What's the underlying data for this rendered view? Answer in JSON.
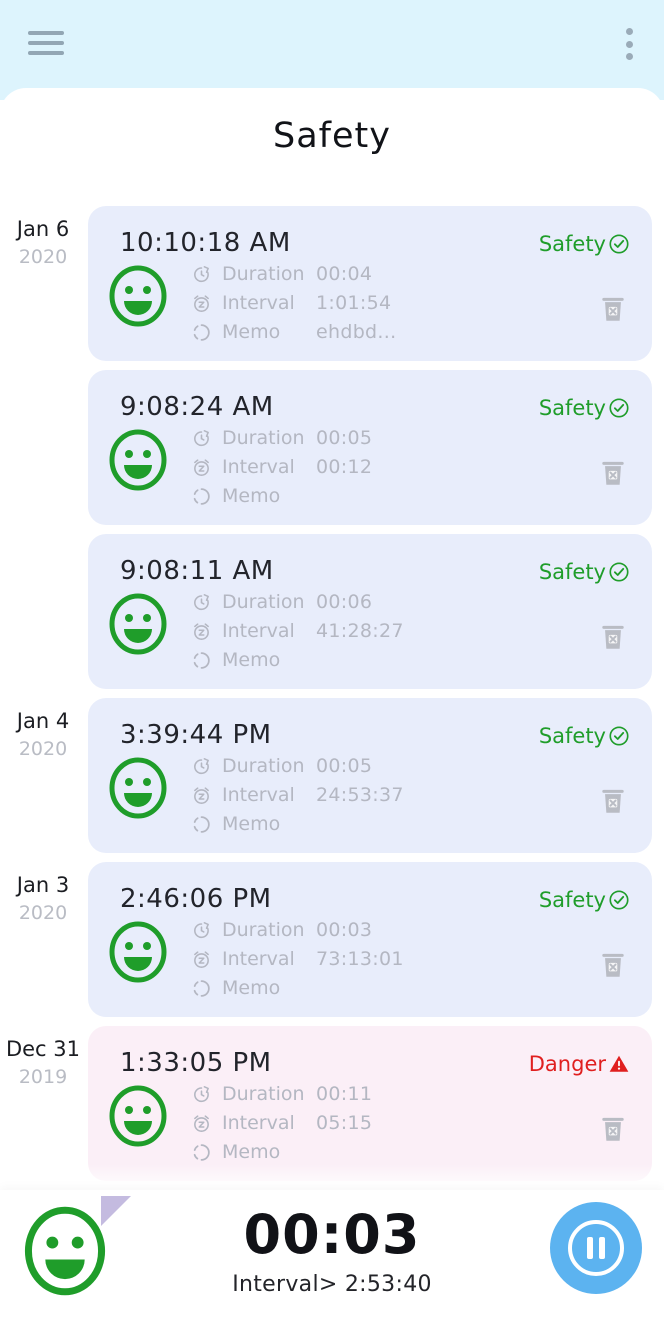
{
  "header": {
    "menu_icon": "hamburger-icon",
    "overflow_icon": "kebab-menu-icon"
  },
  "page": {
    "title": "Safety"
  },
  "labels": {
    "duration": "Duration",
    "interval": "Interval",
    "memo": "Memo",
    "duration_icon": "restore-clock-icon",
    "interval_icon": "snooze-z-icon",
    "memo_icon": "dashed-circle-icon",
    "delete_icon": "trash-x-icon",
    "face_icon": "smiley-face-icon"
  },
  "entries": [
    {
      "date_day": "Jan 6",
      "date_year": "2020",
      "time": "10:10:18 AM",
      "status": "Safety",
      "status_type": "safety",
      "duration": "00:04",
      "interval": "1:01:54",
      "memo": "ehdbd..."
    },
    {
      "date_day": "",
      "date_year": "",
      "time": "9:08:24 AM",
      "status": "Safety",
      "status_type": "safety",
      "duration": "00:05",
      "interval": "00:12",
      "memo": ""
    },
    {
      "date_day": "",
      "date_year": "",
      "time": "9:08:11 AM",
      "status": "Safety",
      "status_type": "safety",
      "duration": "00:06",
      "interval": "41:28:27",
      "memo": ""
    },
    {
      "date_day": "Jan 4",
      "date_year": "2020",
      "time": "3:39:44 PM",
      "status": "Safety",
      "status_type": "safety",
      "duration": "00:05",
      "interval": "24:53:37",
      "memo": ""
    },
    {
      "date_day": "Jan 3",
      "date_year": "2020",
      "time": "2:46:06 PM",
      "status": "Safety",
      "status_type": "safety",
      "duration": "00:03",
      "interval": "73:13:01",
      "memo": ""
    },
    {
      "date_day": "Dec 31",
      "date_year": "2019",
      "time": "1:33:05 PM",
      "status": "Danger",
      "status_type": "danger",
      "duration": "00:11",
      "interval": "05:15",
      "memo": ""
    }
  ],
  "bottom_bar": {
    "timer": "00:03",
    "interval_label": "Interval> 2:53:40",
    "face_icon": "smiley-face-icon",
    "pause_icon": "pause-circle-icon",
    "corner_marker_icon": "corner-triangle-icon"
  },
  "colors": {
    "topbar_bg": "#ddf4fd",
    "card_safety_bg": "#e8edfb",
    "card_danger_bg": "#fbeff7",
    "safety_green": "#1f9d2a",
    "danger_red": "#e01f1f",
    "pause_blue": "#5cb3f0",
    "muted_text": "#b4b7c2"
  }
}
